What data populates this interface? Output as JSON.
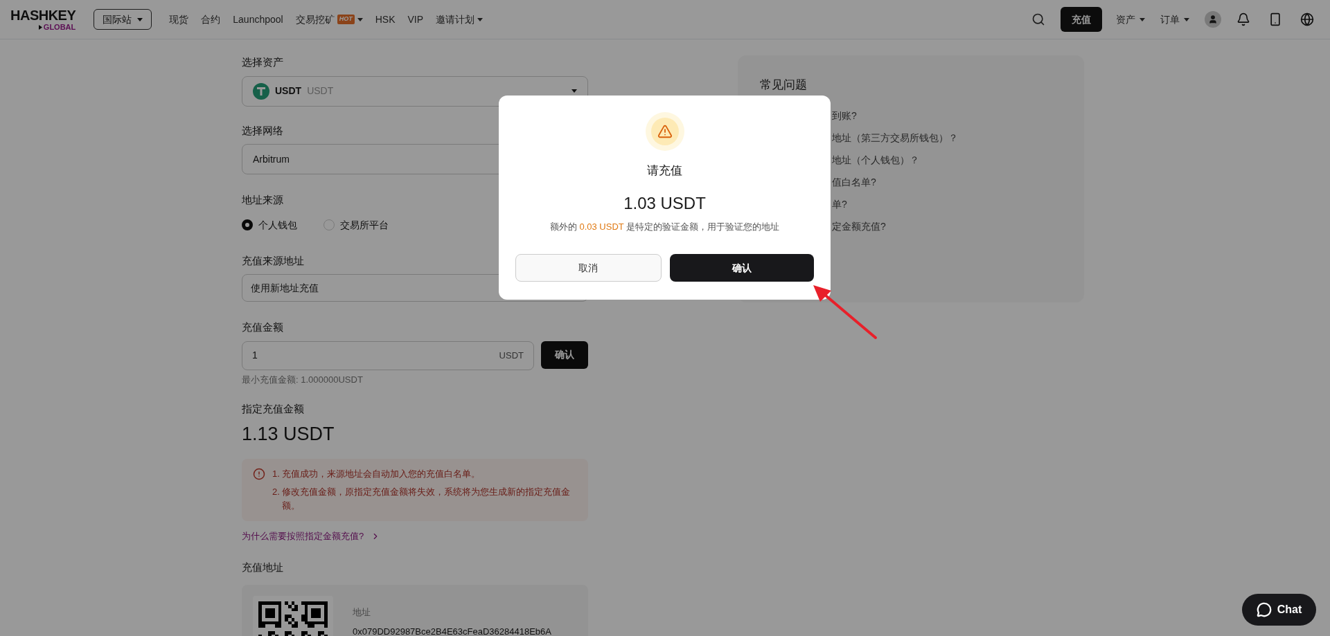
{
  "nav": {
    "logo": {
      "name": "HASHKEY",
      "sub": "GLOBAL"
    },
    "region": "国际站",
    "items": [
      {
        "label": "现货",
        "has_menu": false
      },
      {
        "label": "合约",
        "has_menu": false
      },
      {
        "label": "Launchpool",
        "has_menu": false
      },
      {
        "label": "交易挖矿",
        "badge": "HOT",
        "has_menu": true
      },
      {
        "label": "HSK",
        "has_menu": false
      },
      {
        "label": "VIP",
        "has_menu": false
      },
      {
        "label": "邀请计划",
        "has_menu": true
      }
    ],
    "deposit_button": "充值",
    "menus": [
      {
        "label": "资产"
      },
      {
        "label": "订单"
      }
    ]
  },
  "form": {
    "asset": {
      "label": "选择资产",
      "symbol": "USDT",
      "name": "USDT"
    },
    "network": {
      "label": "选择网络",
      "value": "Arbitrum"
    },
    "address_source": {
      "label": "地址来源",
      "options": [
        {
          "label": "个人钱包",
          "selected": true
        },
        {
          "label": "交易所平台",
          "selected": false
        }
      ]
    },
    "source_address": {
      "label": "充值来源地址",
      "value": "使用新地址充值"
    },
    "amount": {
      "label": "充值金额",
      "value": "1",
      "unit": "USDT",
      "button": "确认",
      "hint": "最小充值金额: 1.000000USDT"
    },
    "specified": {
      "label": "指定充值金额",
      "value": "1.13 USDT"
    },
    "notices": [
      "1. 充值成功，来源地址会自动加入您的充值白名单。",
      "2. 修改充值金额，原指定充值金额将失效，系统将为您生成新的指定充值金额。"
    ],
    "why_link": "为什么需要按照指定金额充值?",
    "deposit_address": {
      "label": "充值地址",
      "field_label": "地址",
      "value": "0x079DD92987Bce2B4E63cFeaD36284418Eb6A"
    }
  },
  "faq": {
    "title": "常见问题",
    "items": [
      "到账?",
      "地址（第三方交易所钱包）？",
      "地址（个人钱包）？",
      "值白名单?",
      "单?",
      "定金额充值?"
    ]
  },
  "modal": {
    "title": "请充值",
    "amount": "1.03 USDT",
    "desc": {
      "before": "额外的 ",
      "highlight": "0.03 USDT",
      "after": " 是特定的验证金额，用于验证您的地址"
    },
    "buttons": [
      {
        "label": "取消",
        "kind": "secondary"
      },
      {
        "label": "确认",
        "kind": "primary"
      }
    ]
  },
  "chat": {
    "label": "Chat"
  }
}
